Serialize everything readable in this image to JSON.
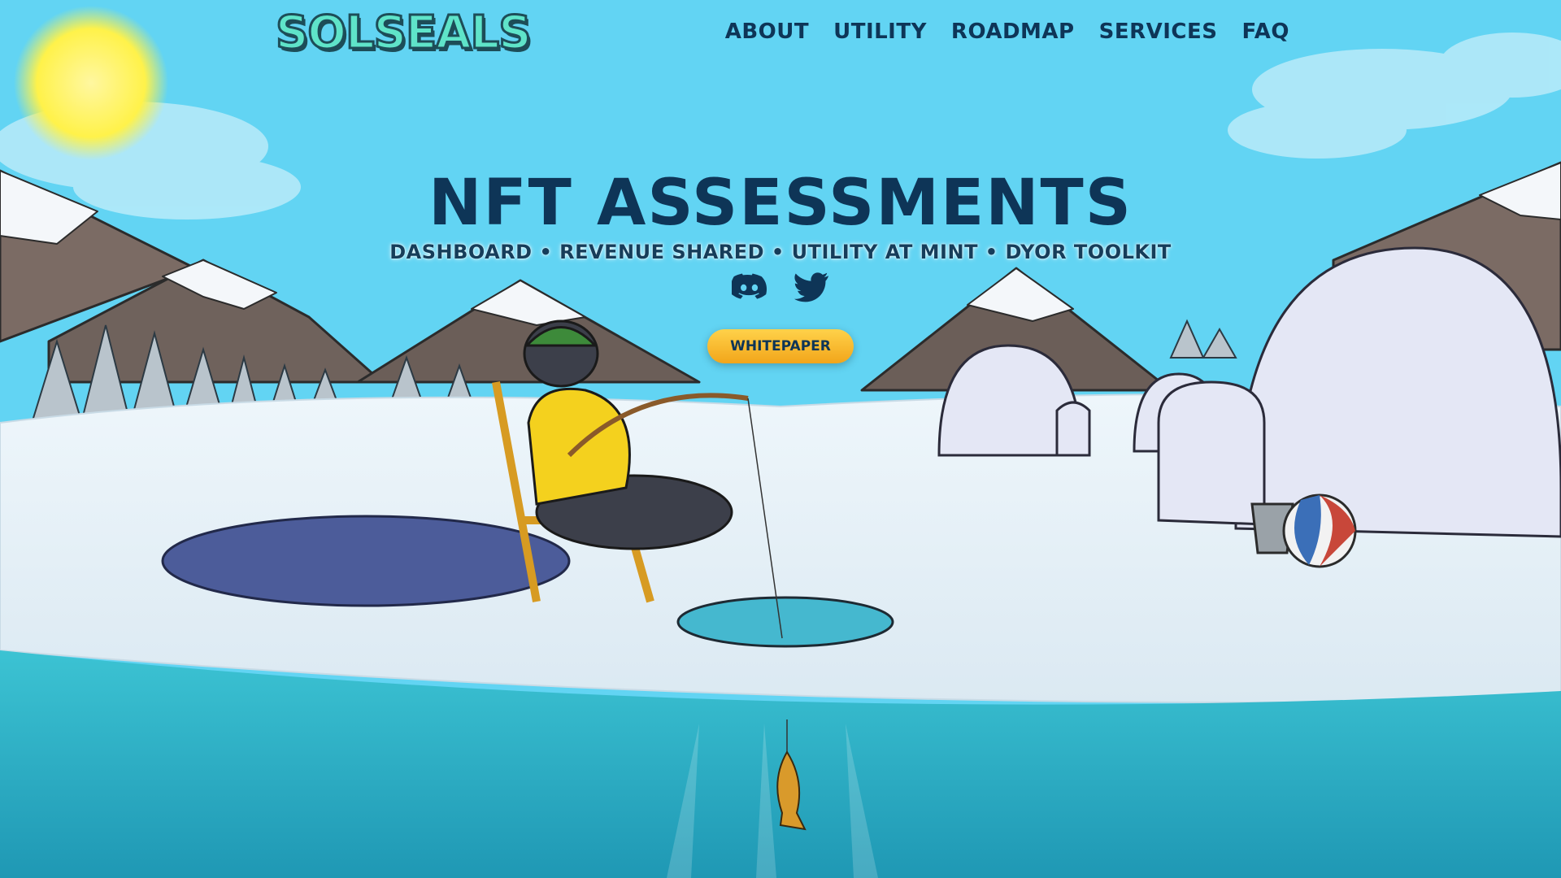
{
  "header": {
    "logo_text": "SOLSEALS",
    "nav": [
      "ABOUT",
      "UTILITY",
      "ROADMAP",
      "SERVICES",
      "FAQ"
    ]
  },
  "hero": {
    "title": "NFT ASSESSMENTS",
    "subtitle": "DASHBOARD • REVENUE SHARED • UTILITY AT MINT • DYOR TOOLKIT",
    "whitepaper_label": "WHITEPAPER",
    "social_icons": [
      "discord-icon",
      "twitter-icon"
    ]
  },
  "colors": {
    "sky": "#62d4f3",
    "title": "#0e3557",
    "logo": "#5fe4c9",
    "button": "#f7b928",
    "water": "#27a7c0"
  }
}
